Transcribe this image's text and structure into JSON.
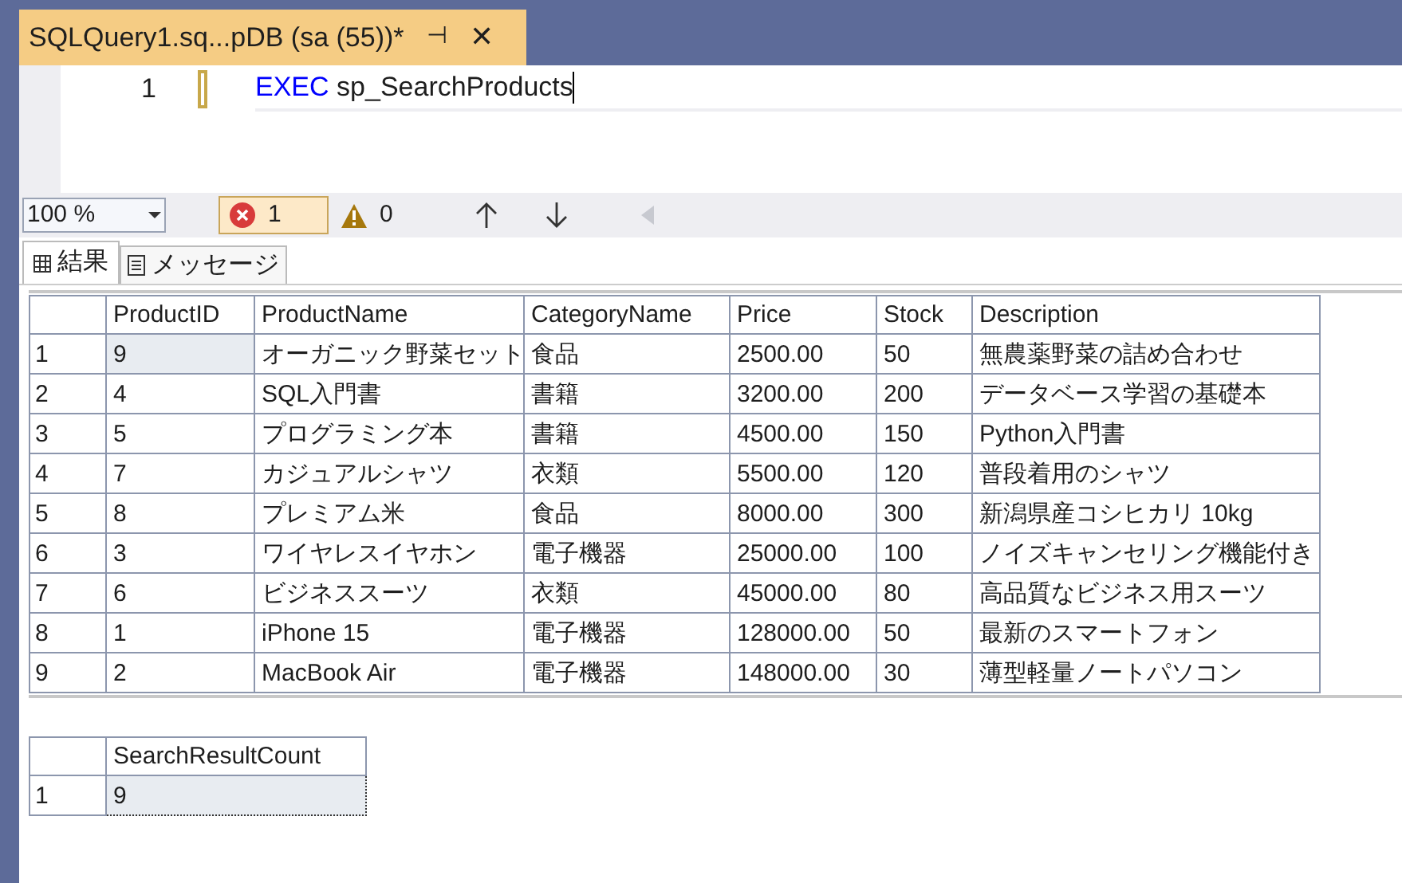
{
  "document_tab": {
    "title": "SQLQuery1.sq...pDB (sa (55))*",
    "pin": "⊣",
    "close": "✕"
  },
  "editor": {
    "lines": [
      {
        "number": "1",
        "keyword": "EXEC",
        "text": "sp_SearchProducts"
      }
    ]
  },
  "toolbar": {
    "zoom": "100 %",
    "errors": {
      "count": "1",
      "selected": true
    },
    "warnings": {
      "count": "0",
      "selected": false
    }
  },
  "result_tabs": [
    {
      "label": "結果",
      "kind": "grid",
      "selected": true
    },
    {
      "label": "メッセージ",
      "kind": "messages",
      "selected": false
    }
  ],
  "result_grids": [
    {
      "columns": [
        "ProductID",
        "ProductName",
        "CategoryName",
        "Price",
        "Stock",
        "Description"
      ],
      "rows": [
        {
          "number": "1",
          "selected": true,
          "cells": [
            "9",
            "オーガニック野菜セット",
            "食品",
            "2500.00",
            "50",
            "無農薬野菜の詰め合わせ"
          ]
        },
        {
          "number": "2",
          "selected": false,
          "cells": [
            "4",
            "SQL入門書",
            "書籍",
            "3200.00",
            "200",
            "データベース学習の基礎本"
          ]
        },
        {
          "number": "3",
          "selected": false,
          "cells": [
            "5",
            "プログラミング本",
            "書籍",
            "4500.00",
            "150",
            "Python入門書"
          ]
        },
        {
          "number": "4",
          "selected": false,
          "cells": [
            "7",
            "カジュアルシャツ",
            "衣類",
            "5500.00",
            "120",
            "普段着用のシャツ"
          ]
        },
        {
          "number": "5",
          "selected": false,
          "cells": [
            "8",
            "プレミアム米",
            "食品",
            "8000.00",
            "300",
            "新潟県産コシヒカリ 10kg"
          ]
        },
        {
          "number": "6",
          "selected": false,
          "cells": [
            "3",
            "ワイヤレスイヤホン",
            "電子機器",
            "25000.00",
            "100",
            "ノイズキャンセリング機能付き"
          ]
        },
        {
          "number": "7",
          "selected": false,
          "cells": [
            "6",
            "ビジネススーツ",
            "衣類",
            "45000.00",
            "80",
            "高品質なビジネス用スーツ"
          ]
        },
        {
          "number": "8",
          "selected": false,
          "cells": [
            "1",
            "iPhone 15",
            "電子機器",
            "128000.00",
            "50",
            "最新のスマートフォン"
          ]
        },
        {
          "number": "9",
          "selected": false,
          "cells": [
            "2",
            "MacBook Air",
            "電子機器",
            "148000.00",
            "30",
            "薄型軽量ノートパソコン"
          ]
        }
      ]
    },
    {
      "columns": [
        "SearchResultCount"
      ],
      "rows": [
        {
          "number": "1",
          "selected": true,
          "cells": [
            "9"
          ]
        }
      ]
    }
  ]
}
